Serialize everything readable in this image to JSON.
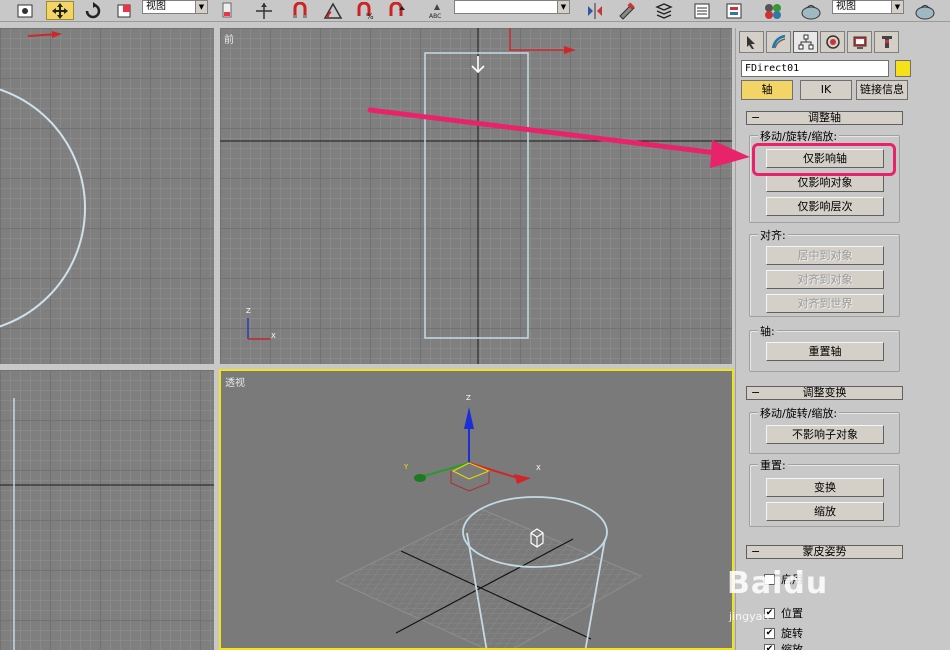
{
  "toolbar": {
    "view_dropdown_1": "视图",
    "view_dropdown_2": "视图",
    "selection_set_dropdown": ""
  },
  "viewports": {
    "front_label": "前",
    "perspective_label": "透视",
    "axis_x": "X",
    "axis_z": "Z",
    "axis_y": "Y"
  },
  "panel": {
    "object_name": "FDirect01",
    "object_color": "#f5e019",
    "hierarchy_tabs": [
      "轴",
      "IK",
      "链接信息"
    ],
    "adjust_pivot": {
      "title": "调整轴",
      "move_group_title": "移动/旋转/缩放:",
      "affect_pivot_only": "仅影响轴",
      "affect_object_only": "仅影响对象",
      "affect_hierarchy_only": "仅影响层次",
      "align_group_title": "对齐:",
      "center_to_object": "居中到对象",
      "align_to_object": "对齐到对象",
      "align_to_world": "对齐到世界",
      "pivot_group_title": "轴:",
      "reset_pivot": "重置轴"
    },
    "adjust_transform": {
      "title": "调整变换",
      "move_group_title": "移动/旋转/缩放:",
      "dont_affect_children": "不影响子对象",
      "reset_group_title": "重置:",
      "transform": "变换",
      "scale": "缩放"
    },
    "skin_pose": {
      "title": "蒙皮姿势",
      "enabled_label": "启用",
      "position_label": "位置",
      "rotation_label": "旋转",
      "scale_label": "缩放"
    }
  },
  "annotation": {
    "color": "#e8236a"
  },
  "watermark": {
    "brand": "Baidu",
    "sub": "jingyan"
  }
}
